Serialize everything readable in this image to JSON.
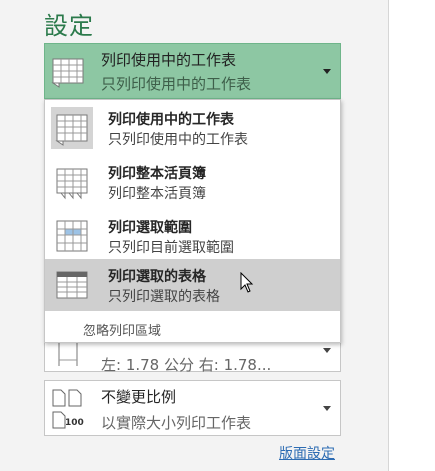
{
  "settings": {
    "title": "設定"
  },
  "print_what": {
    "title": "列印使用中的工作表",
    "subtitle": "只列印使用中的工作表",
    "selected_bg": "#8dc7a3"
  },
  "menu": {
    "items": [
      {
        "title": "列印使用中的工作表",
        "subtitle": "只列印使用中的工作表",
        "icon": "active-sheet-icon"
      },
      {
        "title": "列印整本活頁簿",
        "subtitle": "列印整本活頁簿",
        "icon": "workbook-icon"
      },
      {
        "title": "列印選取範圍",
        "subtitle": "只列印目前選取範圍",
        "icon": "selection-icon"
      },
      {
        "title": "列印選取的表格",
        "subtitle": "只列印選取的表格",
        "icon": "table-icon"
      }
    ],
    "ignore_print_area": "忽略列印區域"
  },
  "margins": {
    "text": "左: 1.78 公分    右: 1.78..."
  },
  "scaling": {
    "title": "不變更比例",
    "subtitle": "以實際大小列印工作表",
    "badge": "100"
  },
  "page_setup": {
    "label": "版面設定"
  },
  "colors": {
    "accent_green": "#2b7a4b",
    "hover_gray": "#cfcfcf",
    "link_blue": "#2d6cb3"
  }
}
